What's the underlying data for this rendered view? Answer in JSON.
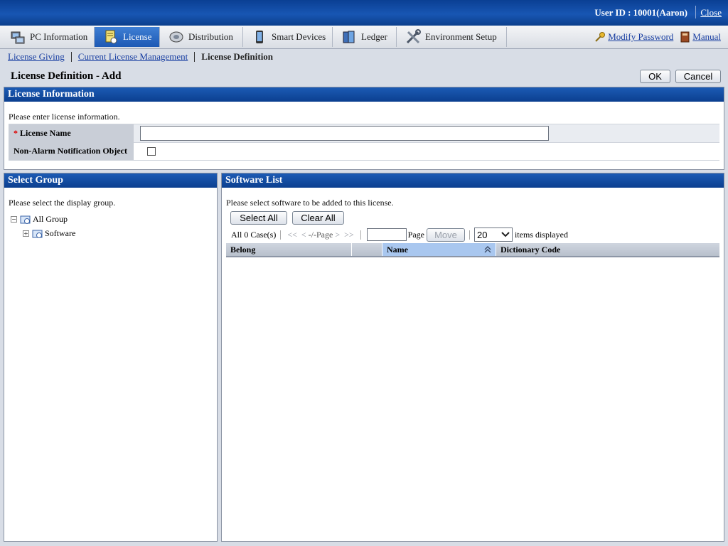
{
  "header": {
    "user_id": "User ID : 10001(Aaron)",
    "close_label": "Close"
  },
  "tabs": [
    {
      "label": "PC Information",
      "icon": "pc-icon"
    },
    {
      "label": "License",
      "icon": "license-icon",
      "active": true
    },
    {
      "label": "Distribution",
      "icon": "distribution-icon"
    },
    {
      "label": "Smart Devices",
      "icon": "smart-device-icon"
    },
    {
      "label": "Ledger",
      "icon": "ledger-icon"
    },
    {
      "label": "Environment Setup",
      "icon": "environment-setup-icon"
    }
  ],
  "toplinks": {
    "modify_password": "Modify Password",
    "manual": "Manual"
  },
  "breadcrumb": {
    "item1": "License Giving",
    "item2": "Current License Management",
    "current": "License Definition"
  },
  "page": {
    "title": "License Definition - Add",
    "ok_label": "OK",
    "cancel_label": "Cancel"
  },
  "license_info": {
    "title": "License Information",
    "hint": "Please enter license information.",
    "required_mark": "*",
    "license_name_label": "License Name",
    "license_name_value": "",
    "non_alarm_label": "Non-Alarm Notification Object",
    "non_alarm_checked": false
  },
  "select_group": {
    "title": "Select Group",
    "hint": "Please select the display group.",
    "tree": {
      "root": "All Group",
      "child": "Software"
    }
  },
  "software_list": {
    "title": "Software List",
    "hint": "Please select software to be added to this license.",
    "select_all_label": "Select All",
    "clear_all_label": "Clear All",
    "pager": {
      "count": "All 0 Case(s)",
      "first": "<<",
      "prev": "<",
      "page_status": "-/-Page",
      "next": ">",
      "last": ">>",
      "page_label": "Page",
      "move_label": "Move",
      "page_size": "20",
      "items_label": "items displayed"
    },
    "columns": [
      "Belong",
      "",
      "Name",
      "Dictionary Code"
    ],
    "rows": []
  },
  "colors": {
    "header_blue": "#0b3f8f",
    "link_blue": "#173da1",
    "active_tab": "#2d6bc4",
    "required_red": "#dd0000"
  }
}
